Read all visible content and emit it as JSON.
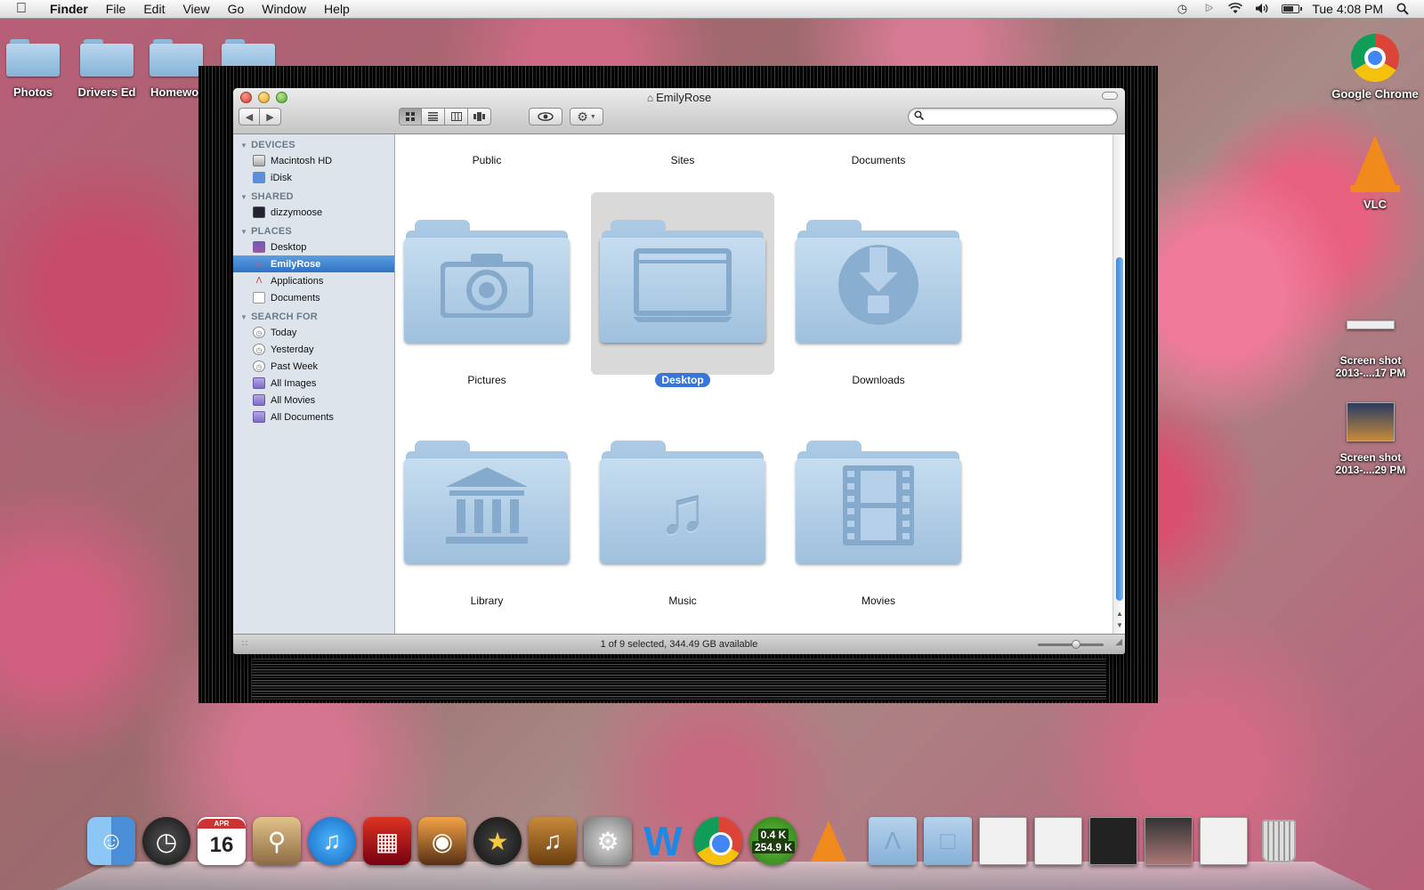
{
  "menubar": {
    "app_name": "Finder",
    "menus": [
      "File",
      "Edit",
      "View",
      "Go",
      "Window",
      "Help"
    ],
    "clock": "Tue 4:08 PM",
    "battery_level": 0.7
  },
  "desktop_left": {
    "items": [
      "Photos",
      "Drivers Ed",
      "Homewor",
      ""
    ]
  },
  "desktop_right": {
    "chrome": "Google Chrome",
    "vlc": "VLC",
    "shot1_line1": "Screen shot",
    "shot1_line2": "2013-....17 PM",
    "shot2_line1": "Screen shot",
    "shot2_line2": "2013-....29 PM"
  },
  "window": {
    "title": "EmilyRose",
    "status": "1 of 9 selected, 344.49 GB available",
    "zoom_level": 0.6
  },
  "sidebar": {
    "devices_header": "DEVICES",
    "devices": [
      "Macintosh HD",
      "iDisk"
    ],
    "shared_header": "SHARED",
    "shared": [
      "dizzymoose"
    ],
    "places_header": "PLACES",
    "places": [
      "Desktop",
      "EmilyRose",
      "Applications",
      "Documents"
    ],
    "search_header": "SEARCH FOR",
    "search": [
      "Today",
      "Yesterday",
      "Past Week",
      "All Images",
      "All Movies",
      "All Documents"
    ]
  },
  "folders": {
    "top_row": [
      "Public",
      "Sites",
      "Documents"
    ],
    "row2": [
      "Pictures",
      "Desktop",
      "Downloads"
    ],
    "row3": [
      "Library",
      "Music",
      "Movies"
    ]
  },
  "dock": {
    "calendar_month": "APR",
    "calendar_day": "16",
    "utorrent_up": "0.4 K",
    "utorrent_down": "254.9 K"
  }
}
